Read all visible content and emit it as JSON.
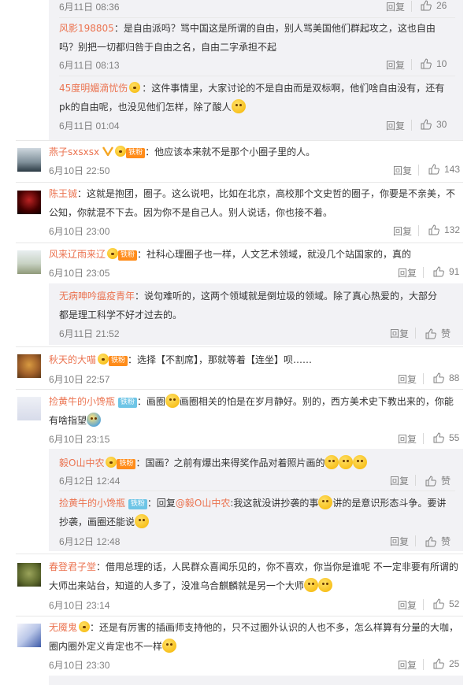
{
  "labels": {
    "reply": "回复"
  },
  "comments": [
    {
      "id": "c0",
      "nested": true,
      "time": "6月11日 08:36",
      "likes": "26"
    },
    {
      "id": "c1",
      "nested": true,
      "name": "风影198805",
      "text": "：是自由派吗？骂中国这是所谓的自由，别人骂美国他们群起攻之，这也自由吗？别把一切都归咎于自由之名，自由二字承担不起",
      "time": "6月11日 08:13",
      "likes": "10"
    },
    {
      "id": "c2",
      "nested": true,
      "name": "45度明媚滴忧伤",
      "text": "：这件事情里，大家讨论的不是自由而是双标啊，他们啥自由没有，还有pk的自由呢，也没见他们怎样，除了酸人",
      "time": "6月11日 01:04",
      "likes": "30"
    },
    {
      "id": "c3",
      "name": "燕子sxsxsx",
      "badge": "铁粉",
      "text": "：他应该本来就不是那个小圈子里的人。",
      "time": "6月10日 22:50",
      "likes": "143"
    },
    {
      "id": "c4",
      "name": "陈王铖",
      "text": "：这就是抱团，圈子。这么说吧，比如在北京，高校那个文史哲的圈子，你要是不亲美，不公知，你就混不下去。因为你不是自己人。别人说话，你也接不着。",
      "time": "6月10日 23:00",
      "likes": "132"
    },
    {
      "id": "c5",
      "name": "风来辽雨来辽",
      "badge": "铁粉",
      "text": "：社科心理圈子也一样，人文艺术领域，就没几个站国家的，真的",
      "time": "6月10日 23:05",
      "likes": "91"
    },
    {
      "id": "c6",
      "nested": true,
      "name": "无病呻吟瘟疫青年",
      "text": "：说句难听的，这两个领域就是倒垃圾的领域。除了真心热爱的，大部分都是理工科学不好才过去的。",
      "time": "6月11日 21:52",
      "likes": "赞"
    },
    {
      "id": "c7",
      "name": "秋天的大喵",
      "badge": "铁粉",
      "text": "：选择【不割席】，那就等着【连坐】呗……",
      "time": "6月10日 22:57",
      "likes": "88"
    },
    {
      "id": "c8",
      "name": "捡黄牛的小馋瓶",
      "badge": "铁粉",
      "text": "：画圈",
      "text2": "画圈相关的怕是在岁月静好。别的，西方美术史下教出来的，你能有啥指望",
      "time": "6月10日 23:15",
      "likes": "55"
    },
    {
      "id": "c9",
      "nested": true,
      "name": "毅O山中农",
      "badge": "铁粉",
      "text": "：国画？之前有爆出来得奖作品对着照片画的",
      "time": "6月12日 12:44",
      "likes": "赞"
    },
    {
      "id": "c10",
      "nested": true,
      "name": "捡黄牛的小馋瓶",
      "badge": "铁粉",
      "text_pre": "：回复",
      "mention": "@毅O山中农",
      "text": ":我这就没讲抄袭的事",
      "text2": "讲的是意识形态斗争。要讲抄袭，画圈还能说",
      "time": "6月12日 12:48",
      "likes": "赞"
    },
    {
      "id": "c11",
      "name": "春登君子堂",
      "text": "：借用总理的话，人民群众喜闻乐见的，你不喜欢，你当你是谁呢 不一定非要有所谓的大师出来站台，知道的人多了，没准乌合麒麟就是另一个大师",
      "time": "6月10日 23:14",
      "likes": "52"
    },
    {
      "id": "c12",
      "name": "无魇鬼",
      "text": "：还是有厉害的插画师支持他的，只不过圈外认识的人也不多，怎么样算有分量的大咖，圈内圈外定义肯定也不一样",
      "time": "6月10日 23:30",
      "likes": "25"
    }
  ]
}
